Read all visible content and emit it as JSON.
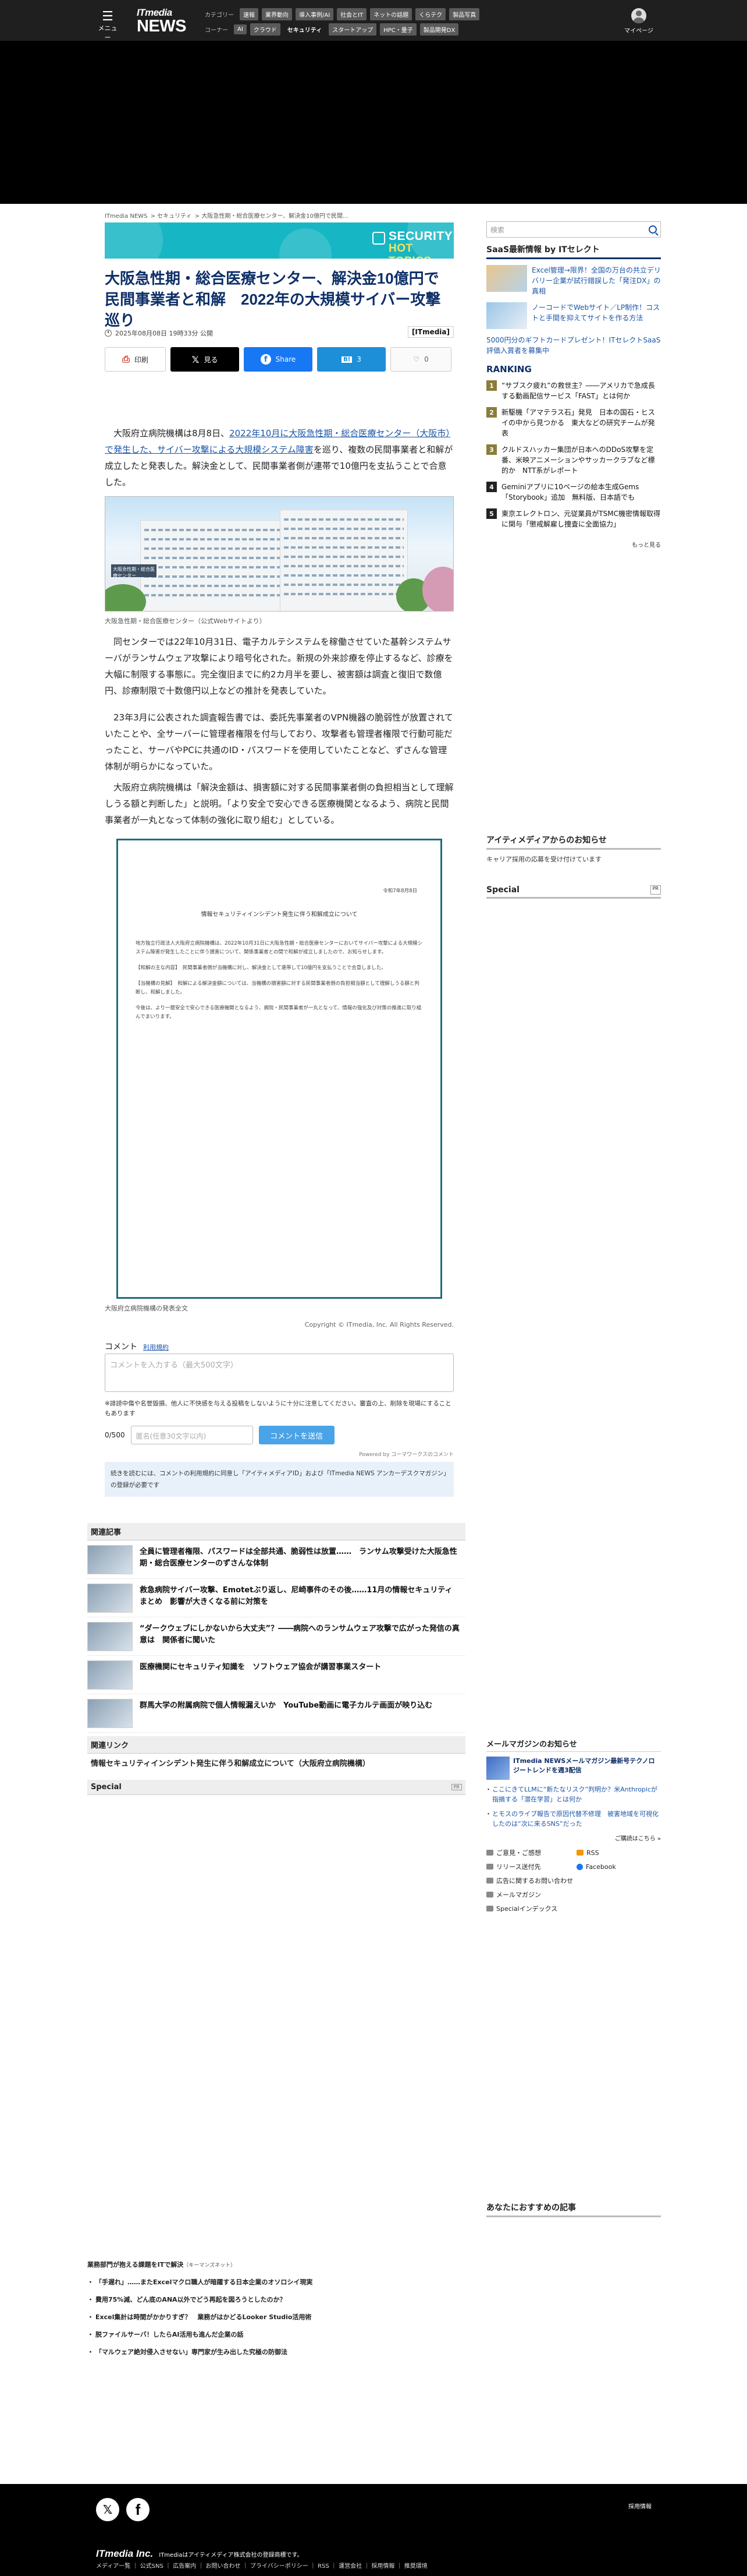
{
  "header": {
    "menu_label": "メニュー",
    "logo_it": "ITmedia",
    "logo_news": "NEWS",
    "row1_label": "カテゴリー",
    "row1": [
      "速報",
      "業界動向",
      "導入事例/AI",
      "社会とIT",
      "ネットの話題",
      "くらテク",
      "製品写真"
    ],
    "row2_label": "コーナー",
    "row2": [
      "AI",
      "クラウド",
      "セキュリティ",
      "スタートアップ",
      "HPC・量子",
      "製品開発DX"
    ],
    "mypage": "マイページ"
  },
  "breadcrumb": [
    "ITmedia NEWS",
    "> セキュリティ",
    "> 大阪急性期・総合医療センター、解決金10億円で民間..."
  ],
  "banner": {
    "line1": "SECURITY",
    "line2": "HOT TOPICS"
  },
  "article": {
    "title": "大阪急性期・総合医療センター、解決金10億円で民間事業者と和解　2022年の大規模サイバー攻撃巡り",
    "date": "2025年08月08日 19時33分 公開",
    "brand": "[ITmedia]",
    "share": {
      "print": "印刷",
      "x": "見る",
      "fb": "Share",
      "hb": "3",
      "like": "0"
    },
    "p1_pre": "　大阪府立病院機構は8月8日、",
    "p1_link": "2022年10月に大阪急性期・総合医療センター（大阪市）で発生した、サイバー攻撃による大規模システム障害",
    "p1_post": "を巡り、複数の民間事業者と和解が成立したと発表した。解決金として、民間事業者側が連帯で10億円を支払うことで合意した。",
    "photo_sign": "大阪急性期・総合医療センター",
    "caption1": "大阪急性期・総合医療センター（公式Webサイトより）",
    "p2": "　同センターでは22年10月31日、電子カルテシステムを稼働させていた基幹システムサーバがランサムウェア攻撃により暗号化された。新規の外来診療を停止するなど、診療を大幅に制限する事態に。完全復旧までに約2カ月半を要し、被害額は調査と復旧で数億円、診療制限で十数億円以上などの推計を発表していた。",
    "p3": "　23年3月に公表された調査報告書では、委託先事業者のVPN機器の脆弱性が放置されていたことや、全サーバーに管理者権限を付与しており、攻撃者も管理者権限で行動可能だったこと、サーバやPCに共通のID・パスワードを使用していたことなど、ずさんな管理体制が明らかになっていた。",
    "p4": "　大阪府立病院機構は「解決金額は、損害額に対する民間事業者側の負担相当として理解しうる額と判断した」と説明。「より安全で安心できる医療機関となるよう、病院と民間事業者が一丸となって体制の強化に取り組む」としている。",
    "doc": {
      "date": "令和7年8月8日",
      "title": "情報セキュリティインシデント発生に伴う和解成立について",
      "b1": "地方独立行政法人大阪府立病院機構は、2022年10月31日に大阪急性期・総合医療センターにおいてサイバー攻撃による大規模システム障害が発生したことに伴う損害について、関係事業者との間で和解が成立しましたので、お知らせします。",
      "b2": "【和解の主な内容】　民間事業者側が当機構に対し、解決金として連帯して10億円を支払うことで合意しました。",
      "b3": "【当機構の見解】　和解による解決金額については、当機構の損害額に対する民間事業者側の負担相当額として理解しうる額と判断し、和解しました。",
      "b4": "今後は、より一層安全で安心できる医療機関となるよう、病院・民間事業者が一丸となって、情報の強化及び対策の推進に取り組んでまいります。"
    },
    "caption2": "大阪府立病院機構の発表全文",
    "copyright": "Copyright © ITmedia, Inc. All Rights Reserved."
  },
  "comment": {
    "label": "コメント",
    "tos": "利用規約",
    "placeholder": "コメントを入力する（最大500文字）",
    "note": "※誹謗中傷や名誉毀損、他人に不快感を与える投稿をしないように十分に注意してください。審査の上、削除を現場にすることもあります",
    "counter": "0/500",
    "name_placeholder": "匿名(任意30文字以内)",
    "send": "コメントを送信",
    "powered": "Powered by コーマワークスのコメント",
    "consent_pre": "続きを読むには、コメントの利用規約に同意し「アイティメディアID」および「ITmedia NEWS アンカーデスクマガジン」の登録が必要です"
  },
  "related": {
    "head": "関連記事",
    "items": [
      "全員に管理者権限、パスワードは全部共通、脆弱性は放置……　ランサム攻撃受けた大阪急性期・総合医療センターのずさんな体制",
      "救急病院サイバー攻撃、Emotetぶり返し、尼崎事件のその後……11月の情報セキュリティまとめ　影響が大きくなる前に対策を",
      "“ダークウェブにしかないから大丈夫”？――病院へのランサムウェア攻撃で広がった発信の真意は　関係者に聞いた",
      "医療機関にセキュリティ知識を　ソフトウェア協会が講習事業スタート",
      "群馬大学の附属病院で個人情報漏えいか　YouTube動画に電子カルテ画面が映り込む"
    ],
    "links_head": "関連リンク",
    "links": [
      "情報セキュリティインシデント発生に伴う和解成立について（大阪府立病院機構）"
    ],
    "special": "Special",
    "pr": "PR"
  },
  "bottom": {
    "head": "業務部門が抱える課題をITで解決",
    "src": "（キーマンズネット）",
    "items": [
      "「手遅れ」……またExcelマクロ職人が暗躍する日本企業のオソロシイ現実",
      "費用75%減、どん底のANA以外でどう再起を図ろうとしたのか？",
      "Excel集計は時間がかかりすぎ？　業務がはかどるLooker Studio活用術",
      "脱ファイルサーバ！したらAI活用も進んだ企業の話",
      "「マルウェア絶対侵入させない」専門家が生み出した究極の防御法"
    ]
  },
  "sidebar": {
    "search_placeholder": "検索",
    "saas_head": "SaaS最新情報 by ITセレクト",
    "saas": [
      "Excel管理→限界！全国の万台の共立デリバリー企業が試行錯誤した「発注DX」の真相",
      "ノーコードでWebサイト／LP制作！コストと手間を抑えてサイトを作る方法"
    ],
    "saas_text": "5000円分のギフトカードプレゼント！ITセレクトSaaS評価入賞者を募集中",
    "ranking_title": "RANKING",
    "ranking": [
      "“サブスク疲れ”の救世主？――アメリカで急成長する動画配信サービス「FAST」とは何か",
      "新駆機「アマテラス石」発見　日本の国石・ヒスイの中から見つかる　東大などの研究チームが発表",
      "クルドスハッカー集団が日本へのDDoS攻撃を定番、米映アニメーションやサッカークラブなど標的か　NTT系がレポート",
      "Geminiアプリに10ページの絵本生成Gems「Storybook」追加　無料版、日本語でも",
      "東京エレクトロン、元従業員がTSMC機密情報取得に関与「懲戒解雇し捜査に全面協力」"
    ],
    "more": "もっと見る",
    "aitmedia_head": "アイティメディアからのお知らせ",
    "aitmedia_link": "キャリア採用の応募を受け付けています",
    "special": "Special",
    "pr": "PR",
    "mm_head": "メールマガジンのお知らせ",
    "mm_title": "ITmedia NEWSメールマガジン最新号テクノロジートレンドを週3配信",
    "mm_items": [
      "ここにきてLLMに“新たなリスク”判明か？米Anthropicが指摘する「潜在学習」とは何か",
      "とモスのライブ報告で原因代替不修理　被害地域を可視化したのは“次に来るSNS”だった"
    ],
    "mm_more": "ご購読はこちら »",
    "links": [
      "ご意見・ご感想",
      "RSS",
      "リリース送付先",
      "Facebook",
      "広告に関するお問い合わせ",
      "",
      "メールマガジン",
      "",
      "Specialインデックス",
      ""
    ],
    "recommend": "あなたにおすすめの記事"
  },
  "footer": {
    "recruit": "採用情報",
    "logo": "ITmedia Inc.",
    "tm": "ITmediaはアイティメディア株式会社の登録商標です。",
    "links": "メディア一覧 ｜ 公式SNS ｜ 広告案内 ｜ お問い合わせ ｜ プライバシーポリシー ｜ RSS ｜ 運営会社 ｜ 採用情報 ｜ 推奨環境"
  }
}
